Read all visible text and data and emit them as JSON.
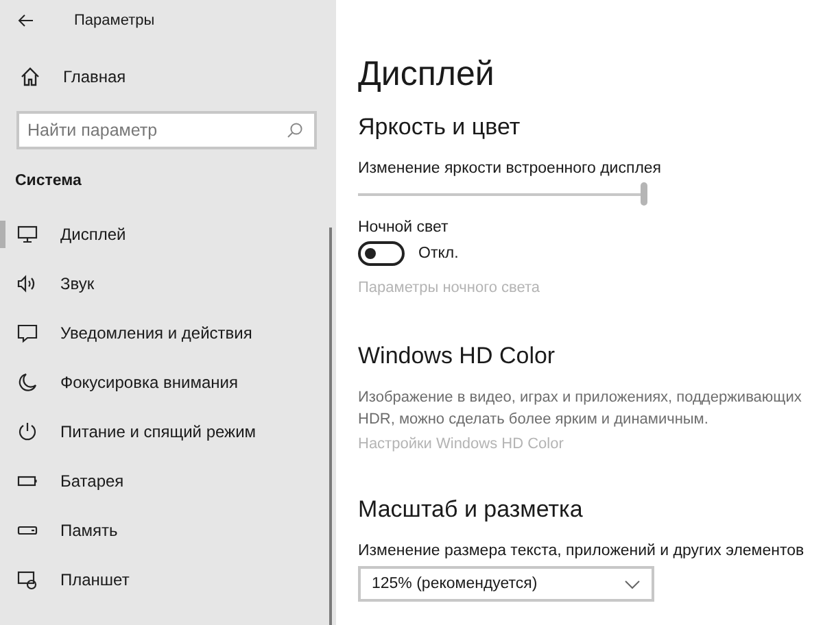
{
  "window": {
    "title": "Параметры"
  },
  "sidebar": {
    "home": "Главная",
    "search": {
      "placeholder": "Найти параметр"
    },
    "section": "Система",
    "items": [
      {
        "label": "Дисплей",
        "kind": "display",
        "selected": true
      },
      {
        "label": "Звук",
        "kind": "sound",
        "selected": false
      },
      {
        "label": "Уведомления и действия",
        "kind": "notifications",
        "selected": false
      },
      {
        "label": "Фокусировка внимания",
        "kind": "focus",
        "selected": false
      },
      {
        "label": "Питание и спящий режим",
        "kind": "power",
        "selected": false
      },
      {
        "label": "Батарея",
        "kind": "battery",
        "selected": false
      },
      {
        "label": "Память",
        "kind": "storage",
        "selected": false
      },
      {
        "label": "Планшет",
        "kind": "tablet",
        "selected": false
      }
    ]
  },
  "page": {
    "title": "Дисплей",
    "brightness": {
      "heading": "Яркость и цвет",
      "label": "Изменение яркости встроенного дисплея",
      "level": 1.0,
      "night_light": {
        "label": "Ночной свет",
        "on": false,
        "state_text": "Откл."
      },
      "link": {
        "text": "Параметры ночного света",
        "disabled": true
      }
    },
    "hdr": {
      "heading": "Windows HD Color",
      "description": "Изображение в видео, играх и приложениях, поддерживающих HDR, можно сделать более ярким и динамичным.",
      "link": {
        "text": "Настройки Windows HD Color",
        "disabled": true
      }
    },
    "scale": {
      "heading": "Масштаб и разметка",
      "label": "Изменение размера текста, приложений и других элементов",
      "value": "125% (рекомендуется)"
    }
  }
}
